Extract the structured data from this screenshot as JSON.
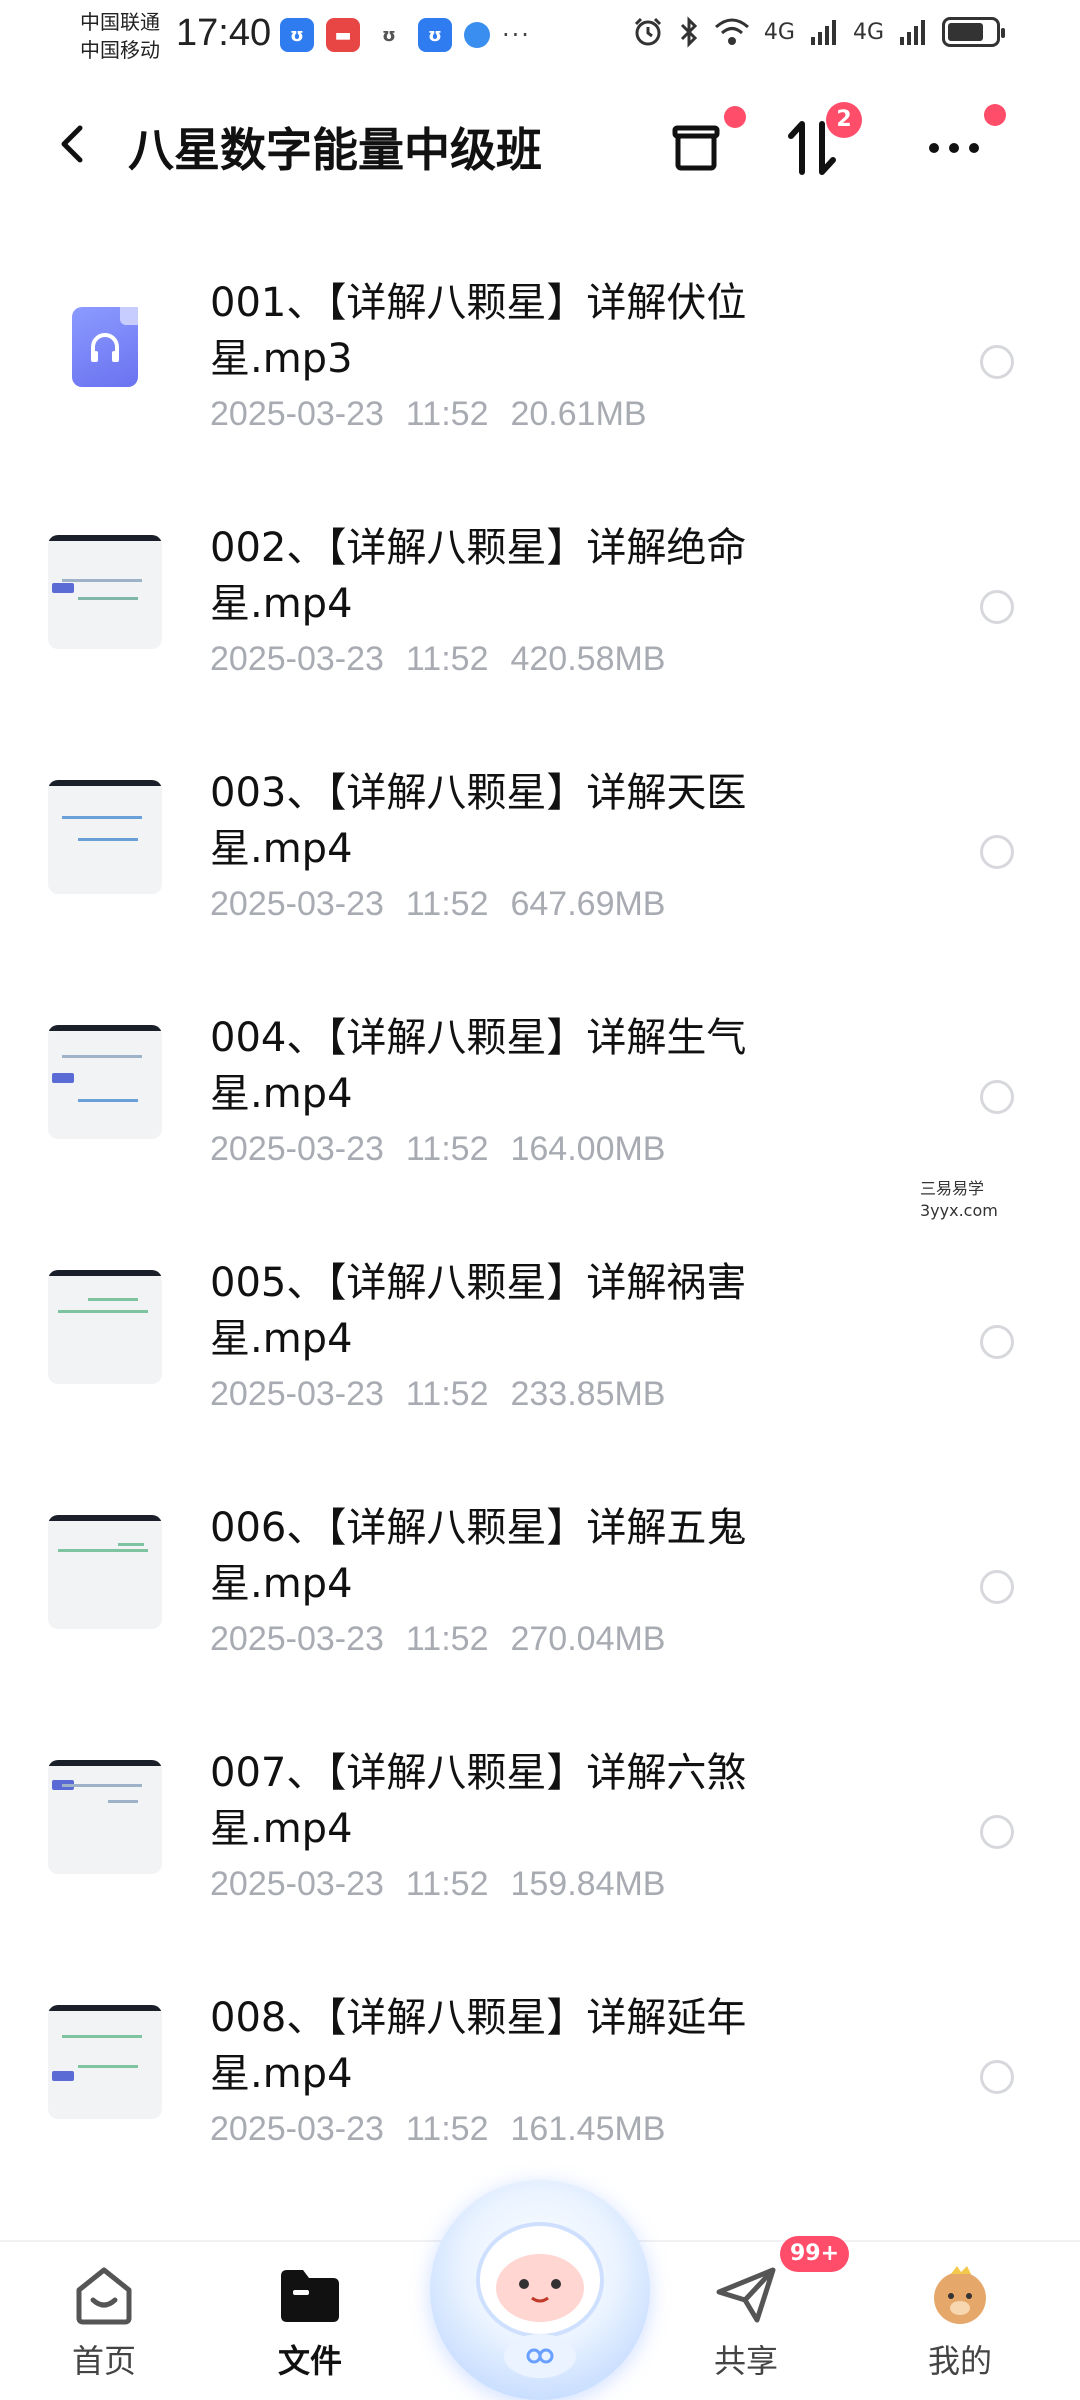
{
  "status_bar": {
    "carrier1": "中国联通",
    "carrier2": "中国移动",
    "time": "17:40",
    "signal1": "4G",
    "signal2": "4G",
    "battery_level": 0.75
  },
  "header": {
    "title": "八星数字能量中级班",
    "sort_badge": "2"
  },
  "files": [
    {
      "name": "001、【详解八颗星】详解伏位星.mp3",
      "date": "2025-03-23",
      "time": "11:52",
      "size": "20.61MB",
      "type": "audio"
    },
    {
      "name": "002、【详解八颗星】详解绝命星.mp4",
      "date": "2025-03-23",
      "time": "11:52",
      "size": "420.58MB",
      "type": "video"
    },
    {
      "name": "003、【详解八颗星】详解天医星.mp4",
      "date": "2025-03-23",
      "time": "11:52",
      "size": "647.69MB",
      "type": "video"
    },
    {
      "name": "004、【详解八颗星】详解生气星.mp4",
      "date": "2025-03-23",
      "time": "11:52",
      "size": "164.00MB",
      "type": "video"
    },
    {
      "name": "005、【详解八颗星】详解祸害星.mp4",
      "date": "2025-03-23",
      "time": "11:52",
      "size": "233.85MB",
      "type": "video"
    },
    {
      "name": "006、【详解八颗星】详解五鬼星.mp4",
      "date": "2025-03-23",
      "time": "11:52",
      "size": "270.04MB",
      "type": "video"
    },
    {
      "name": "007、【详解八颗星】详解六煞星.mp4",
      "date": "2025-03-23",
      "time": "11:52",
      "size": "159.84MB",
      "type": "video"
    },
    {
      "name": "008、【详解八颗星】详解延年星.mp4",
      "date": "2025-03-23",
      "time": "11:52",
      "size": "161.45MB",
      "type": "video"
    }
  ],
  "watermark": {
    "line1": "三易易学",
    "line2": "3yyx.com"
  },
  "bottom_nav": {
    "home": "首页",
    "files": "文件",
    "share": "共享",
    "mine": "我的",
    "share_badge": "99+"
  },
  "colors": {
    "accent_red": "#ff4d6a",
    "audio_icon": "#6b72f0",
    "meta_gray": "#a8abb2"
  }
}
